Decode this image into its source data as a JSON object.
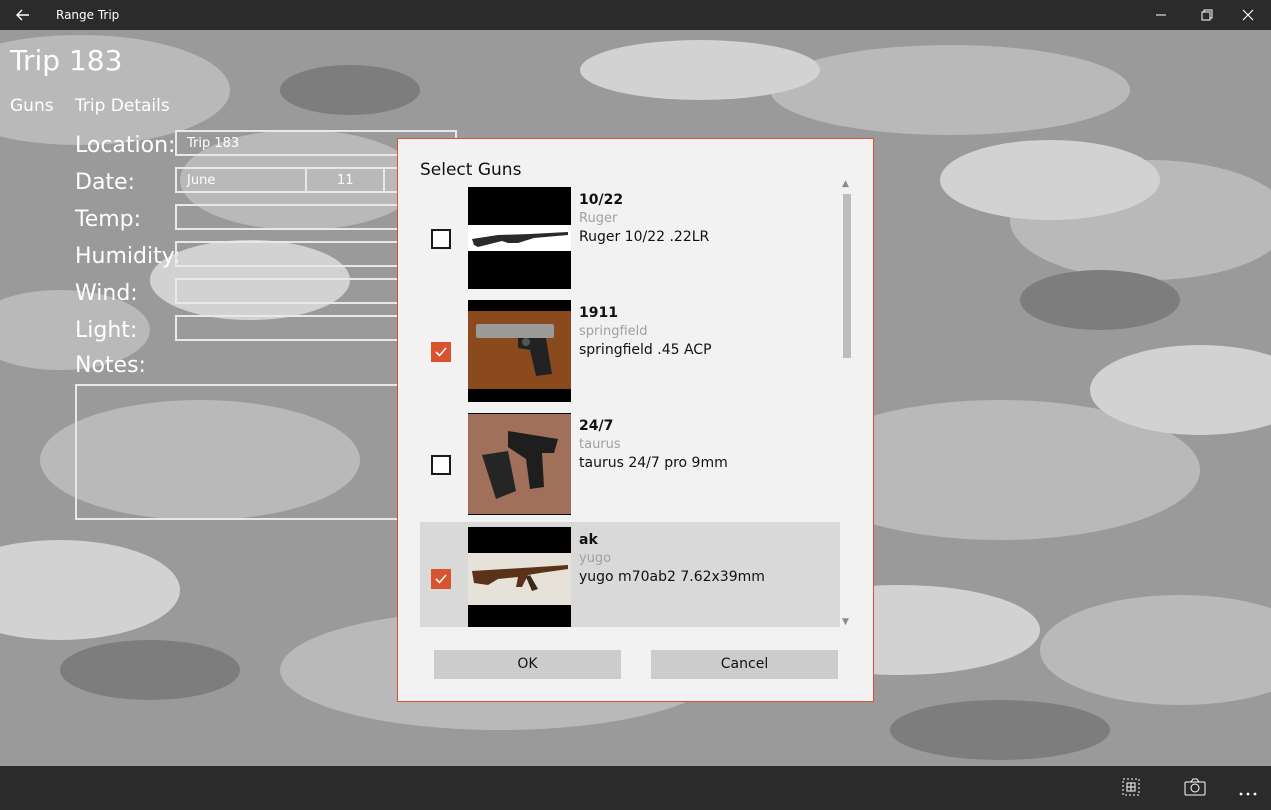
{
  "window": {
    "title": "Range Trip"
  },
  "page": {
    "title": "Trip 183"
  },
  "pivot": {
    "guns": "Guns",
    "trip_details": "Trip Details"
  },
  "form": {
    "location_label": "Location:",
    "location_value": "Trip 183",
    "date_label": "Date:",
    "date_month": "June",
    "date_day": "11",
    "temp_label": "Temp:",
    "humidity_label": "Humidity:",
    "wind_label": "Wind:",
    "light_label": "Light:",
    "notes_label": "Notes:"
  },
  "dialog": {
    "title": "Select Guns",
    "items": [
      {
        "name": "10/22",
        "make": "Ruger",
        "description": "Ruger 10/22 .22LR",
        "checked": false,
        "thumb": "rifle-photo"
      },
      {
        "name": "1911",
        "make": "springfield",
        "description": "springfield  .45 ACP",
        "checked": true,
        "thumb": "pistol-photo"
      },
      {
        "name": "24/7",
        "make": "taurus",
        "description": "taurus 24/7 pro 9mm",
        "checked": false,
        "thumb": "pistol-holster-photo"
      },
      {
        "name": "ak",
        "make": "yugo",
        "description": "yugo m70ab2 7.62x39mm",
        "checked": true,
        "thumb": "ak-rifle-photo"
      }
    ],
    "ok_label": "OK",
    "cancel_label": "Cancel"
  },
  "appbar": {
    "icons": [
      "select-all-icon",
      "camera-icon",
      "more-icon"
    ]
  },
  "colors": {
    "accent": "#d9532e",
    "chrome": "#2b2b2b",
    "dialog_bg": "#f2f2f2"
  }
}
